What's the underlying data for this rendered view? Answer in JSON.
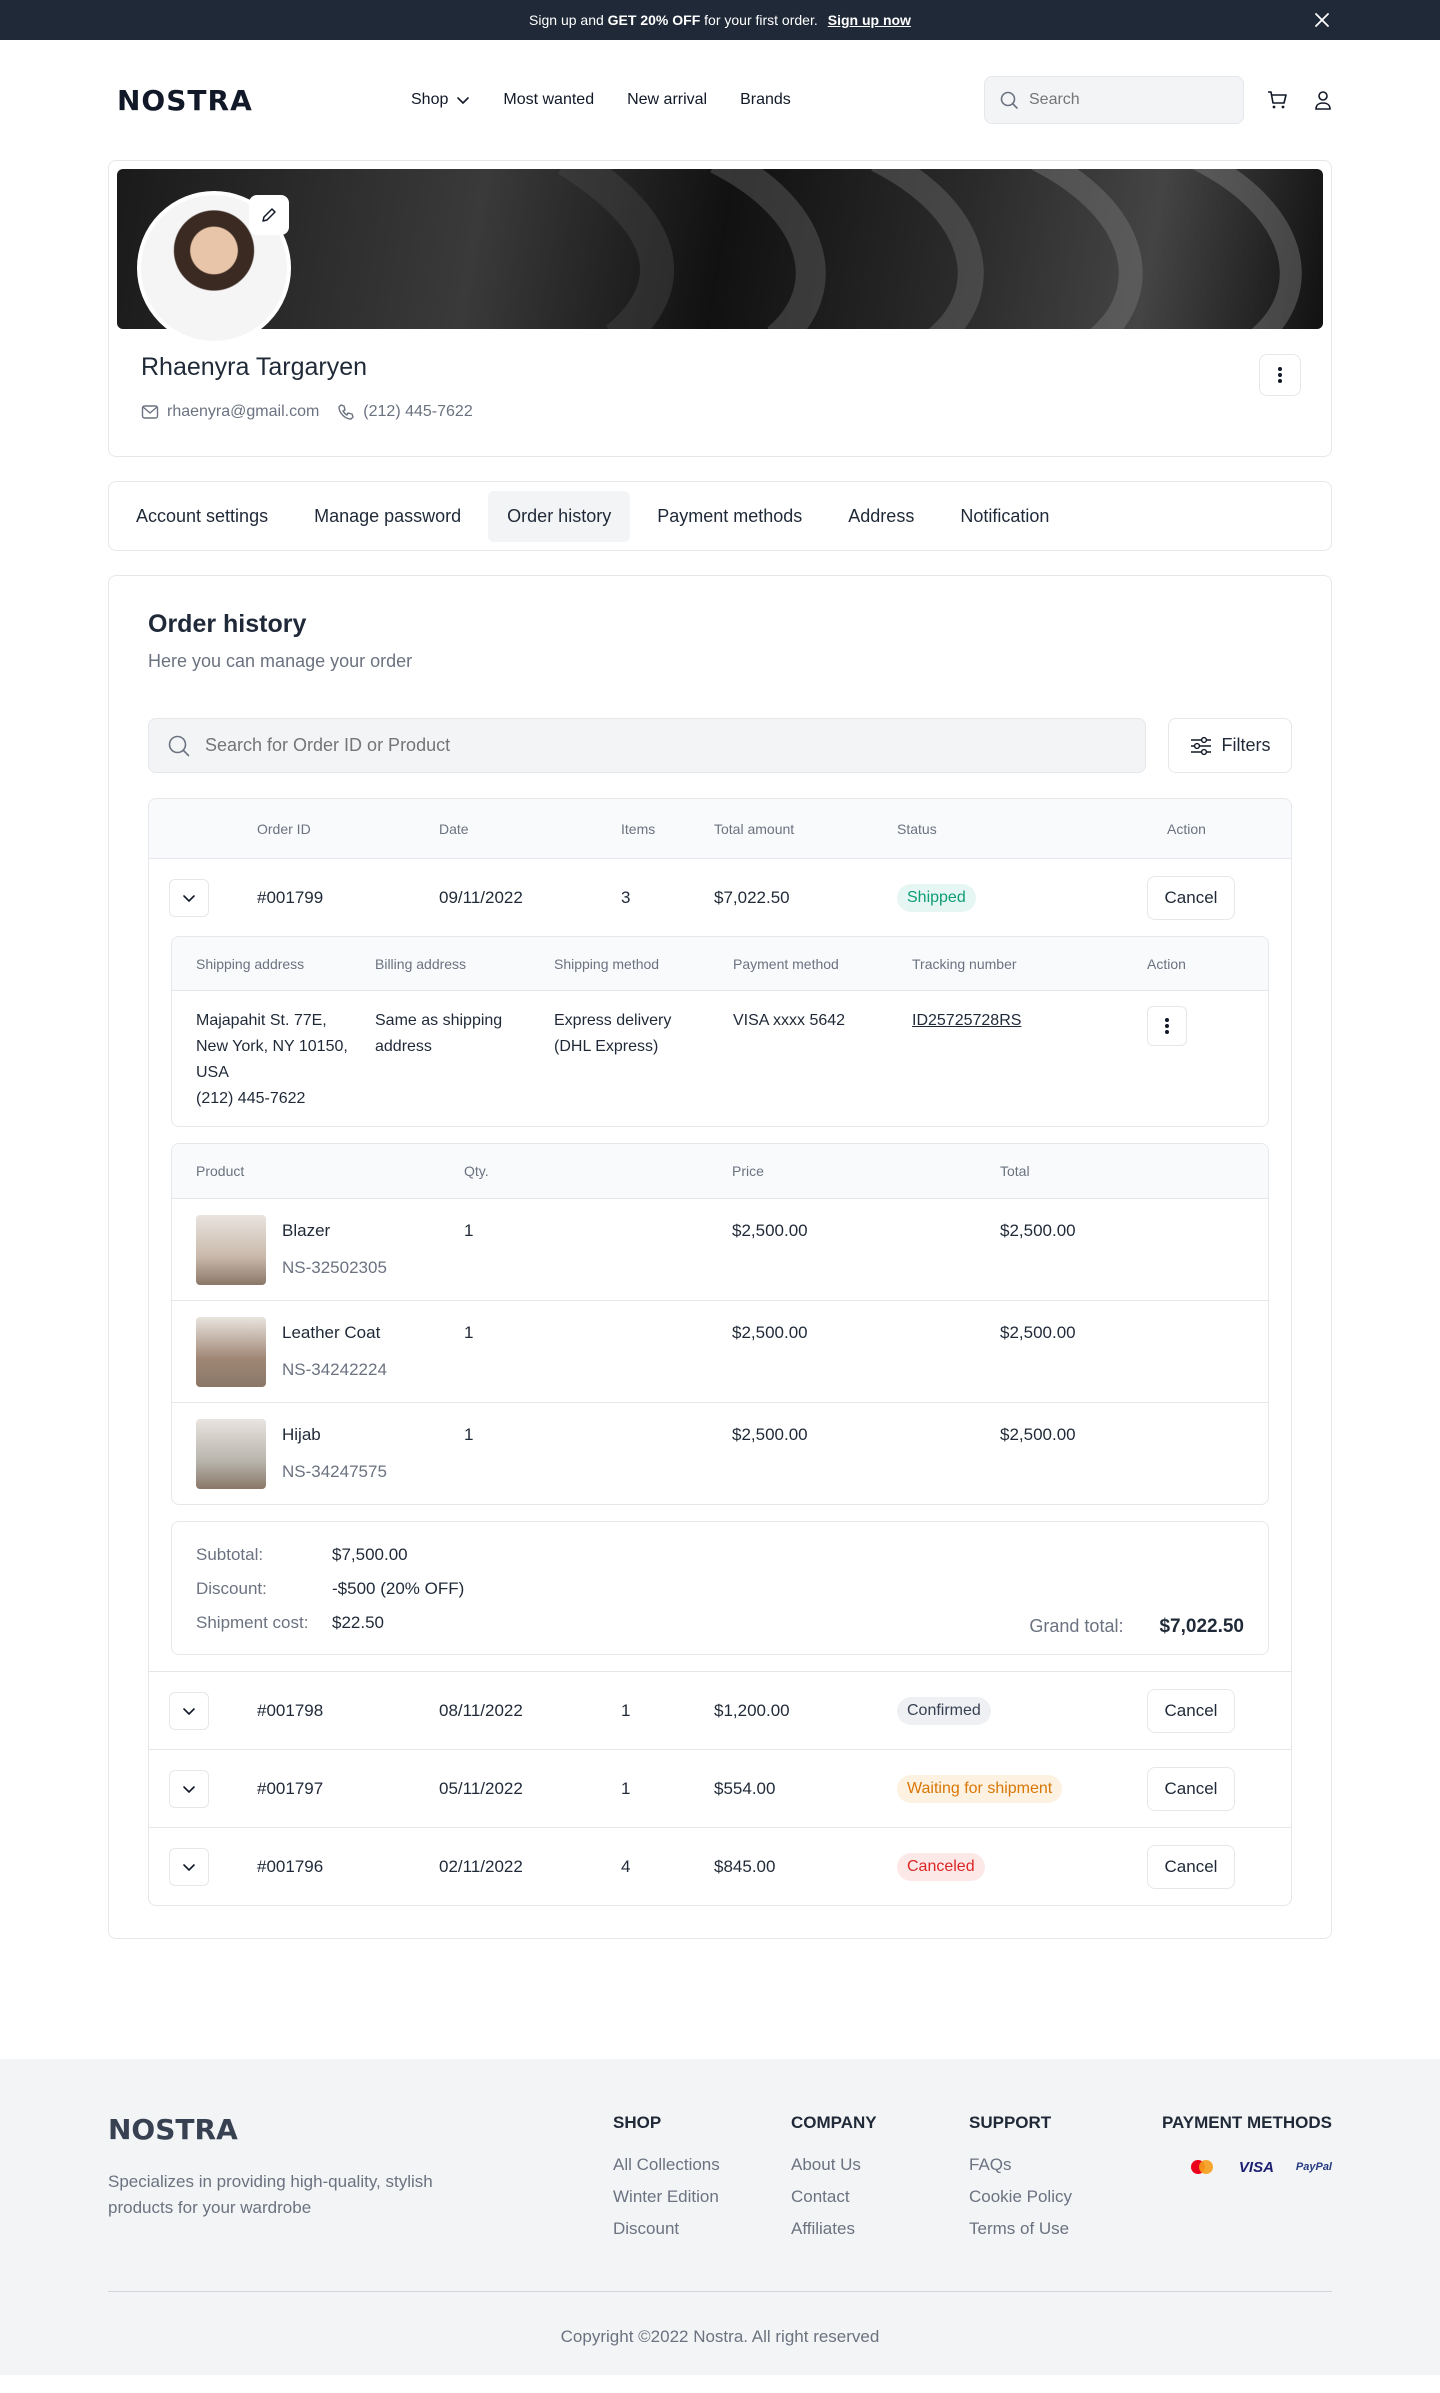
{
  "promo": {
    "text_pre": "Sign up and",
    "text_strong": "GET 20% OFF",
    "text_post": "for your first order.",
    "link": "Sign up now"
  },
  "header": {
    "logo": "NOSTRA",
    "nav": [
      "Shop",
      "Most wanted",
      "New arrival",
      "Brands"
    ],
    "search_placeholder": "Search"
  },
  "profile": {
    "name": "Rhaenyra Targaryen",
    "email": "rhaenyra@gmail.com",
    "phone": "(212) 445-7622"
  },
  "tabs": [
    "Account settings",
    "Manage password",
    "Order history",
    "Payment methods",
    "Address",
    "Notification"
  ],
  "active_tab": "Order history",
  "orders_section": {
    "title": "Order history",
    "subtitle": "Here you can manage your order",
    "search_placeholder": "Search for Order ID or Product",
    "filters_label": "Filters",
    "columns": [
      "Order ID",
      "Date",
      "Items",
      "Total amount",
      "Status",
      "Action"
    ],
    "cancel_label": "Cancel",
    "orders": [
      {
        "id": "#001799",
        "date": "09/11/2022",
        "items": "3",
        "total": "$7,022.50",
        "status": "Shipped",
        "status_bg": "#e6f6f2",
        "status_color": "#0f9d76"
      },
      {
        "id": "#001798",
        "date": "08/11/2022",
        "items": "1",
        "total": "$1,200.00",
        "status": "Confirmed",
        "status_bg": "#eef0f3",
        "status_color": "#374151"
      },
      {
        "id": "#001797",
        "date": "05/11/2022",
        "items": "1",
        "total": "$554.00",
        "status": "Waiting for shipment",
        "status_bg": "#fdf1e1",
        "status_color": "#d97706"
      },
      {
        "id": "#001796",
        "date": "02/11/2022",
        "items": "4",
        "total": "$845.00",
        "status": "Canceled",
        "status_bg": "#fde8e8",
        "status_color": "#dc2626"
      }
    ],
    "detail": {
      "ship_columns": [
        "Shipping address",
        "Billing address",
        "Shipping method",
        "Payment method",
        "Tracking number",
        "Action"
      ],
      "shipping_address": "Majapahit St. 77E,\nNew York, NY 10150,\nUSA\n(212) 445-7622",
      "billing_address": "Same as shipping\naddress",
      "shipping_method": "Express delivery\n(DHL Express)",
      "payment_method": "VISA xxxx 5642",
      "tracking_number": "ID25725728RS",
      "product_columns": [
        "Product",
        "Qty.",
        "Price",
        "Total"
      ],
      "products": [
        {
          "name": "Blazer",
          "sku": "NS-32502305",
          "qty": "1",
          "price": "$2,500.00",
          "total": "$2,500.00",
          "thumb_color": "#c9b9ab"
        },
        {
          "name": "Leather Coat",
          "sku": "NS-34242224",
          "qty": "1",
          "price": "$2,500.00",
          "total": "$2,500.00",
          "thumb_color": "#a08775"
        },
        {
          "name": "Hijab",
          "sku": "NS-34247575",
          "qty": "1",
          "price": "$2,500.00",
          "total": "$2,500.00",
          "thumb_color": "#b8b5ad"
        }
      ],
      "summary": {
        "subtotal_label": "Subtotal:",
        "subtotal": "$7,500.00",
        "discount_label": "Discount:",
        "discount": "-$500 (20% OFF)",
        "shipment_label": "Shipment cost:",
        "shipment": "$22.50",
        "grand_label": "Grand total:",
        "grand_total": "$7,022.50"
      }
    }
  },
  "footer": {
    "logo": "NOSTRA",
    "tagline": "Specializes in providing high-quality, stylish products for your wardrobe",
    "columns": [
      {
        "title": "SHOP",
        "links": [
          "All Collections",
          "Winter Edition",
          "Discount"
        ]
      },
      {
        "title": "COMPANY",
        "links": [
          "About Us",
          "Contact",
          "Affiliates"
        ]
      },
      {
        "title": "SUPPORT",
        "links": [
          "FAQs",
          "Cookie Policy",
          "Terms of Use"
        ]
      }
    ],
    "payment_title": "PAYMENT METHODS",
    "payment_icons": [
      "mastercard-icon",
      "visa-icon",
      "paypal-icon"
    ],
    "visa_text": "VISA",
    "paypal_text": "PayPal",
    "copyright": "Copyright ©2022 Nostra. All right reserved"
  }
}
